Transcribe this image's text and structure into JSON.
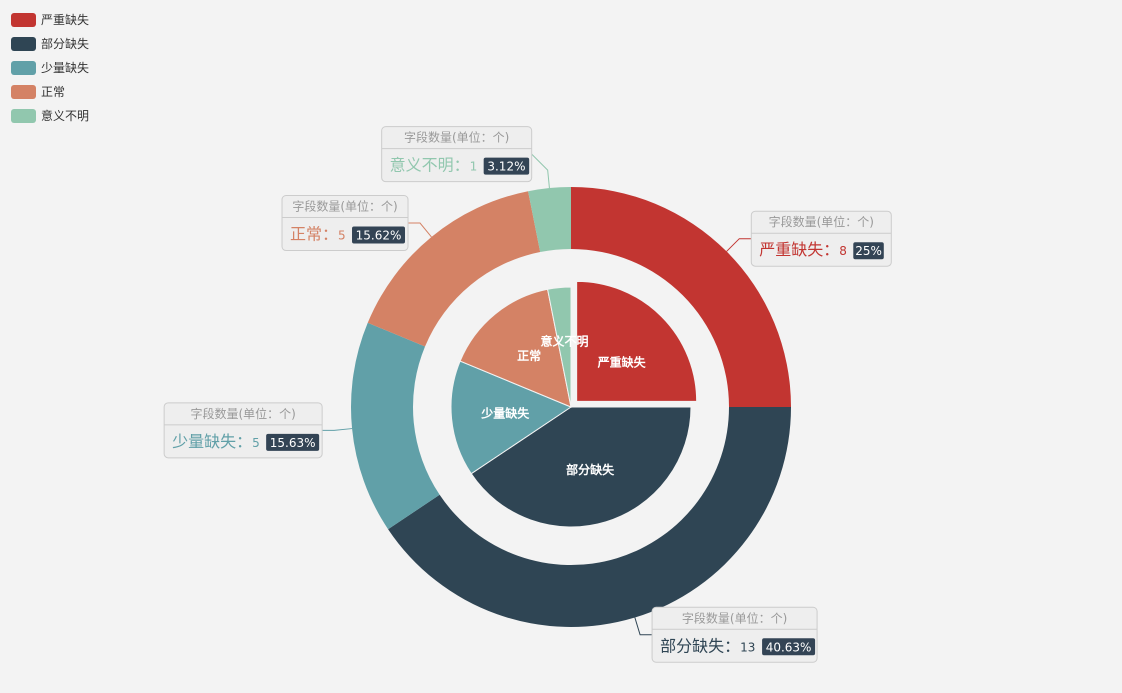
{
  "chart_data": {
    "type": "pie",
    "legend_placement": "top-left",
    "callout_title": "字段数量(单位：个)",
    "categories": [
      "严重缺失",
      "部分缺失",
      "少量缺失",
      "正常",
      "意义不明"
    ],
    "values": [
      8,
      13,
      5,
      5,
      1
    ],
    "percentages": [
      "25%",
      "40.63%",
      "15.63%",
      "15.62%",
      "3.12%"
    ],
    "colors": [
      "#c23531",
      "#2f4554",
      "#61a0a8",
      "#d48265",
      "#91c7ae"
    ],
    "rings": [
      "inner pie",
      "outer donut"
    ]
  }
}
